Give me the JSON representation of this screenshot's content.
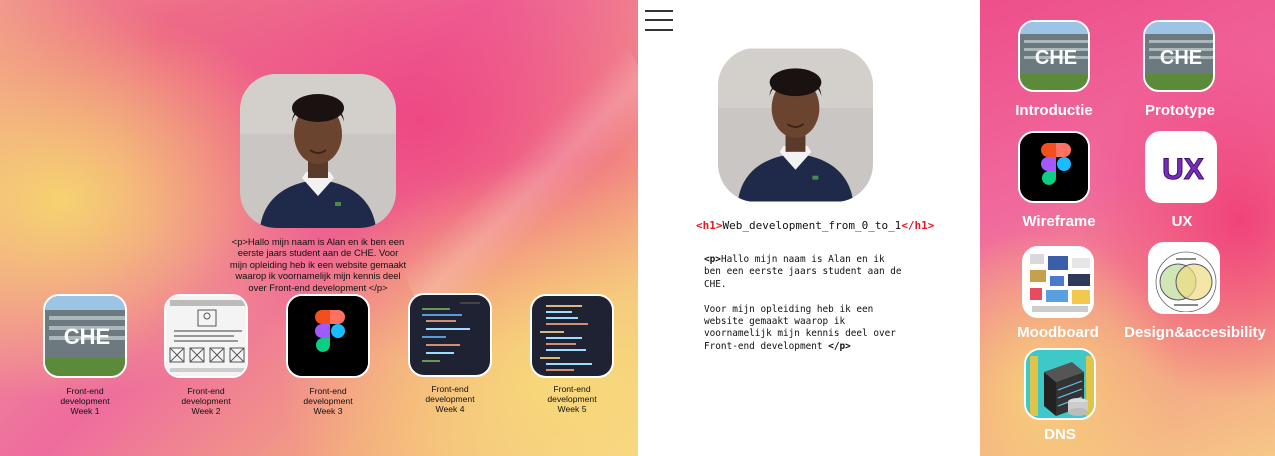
{
  "left_panel": {
    "intro_text": "<p>Hallo mijn naam is Alan en ik ben een eerste jaars student aan de CHE. Voor mijn opleiding heb ik een website gemaakt waarop ik voornamelijk mijn kennis deel over Front-end development </p>",
    "weeks": [
      {
        "label_line1": "Front-end",
        "label_line2": "development",
        "label_line3": "Week 1",
        "thumb_text": "CHE"
      },
      {
        "label_line1": "Front-end",
        "label_line2": "development",
        "label_line3": "Week 2"
      },
      {
        "label_line1": "Front-end",
        "label_line2": "development",
        "label_line3": "Week 3"
      },
      {
        "label_line1": "Front-end",
        "label_line2": "development",
        "label_line3": "Week 4"
      },
      {
        "label_line1": "Front-end",
        "label_line2": "development",
        "label_line3": "Week 5"
      }
    ]
  },
  "middle_panel": {
    "h1_open": "<h1>",
    "h1_text": "Web_development_from_0_to_1",
    "h1_close": "</h1>",
    "p_open": "<p>",
    "p_text_1": "Hallo mijn naam is Alan en ik ben een eerste jaars student aan de CHE.",
    "p_text_2": "Voor mijn opleiding heb ik een website gemaakt waarop ik voornamelijk mijn kennis deel over Front-end development",
    "p_close": "</p>"
  },
  "right_panel": {
    "apps": [
      {
        "label": "Introductie",
        "icon": "che-building-icon",
        "thumb_text": "CHE"
      },
      {
        "label": "Prototype",
        "icon": "che-building-icon",
        "thumb_text": "CHE"
      },
      {
        "label": "Wireframe",
        "icon": "figma-icon"
      },
      {
        "label": "UX",
        "icon": "ux-icon",
        "thumb_text": "UX"
      },
      {
        "label": "Moodboard",
        "icon": "moodboard-icon"
      },
      {
        "label": "Design&accesibility",
        "icon": "venn-diagram-icon"
      },
      {
        "label": "DNS",
        "icon": "server-icon"
      }
    ]
  },
  "colors": {
    "pink": "#ee4f8b",
    "yellow": "#f6d58a",
    "code_tag_red": "#e01b24",
    "ux_purple": "#7b2cbf"
  }
}
